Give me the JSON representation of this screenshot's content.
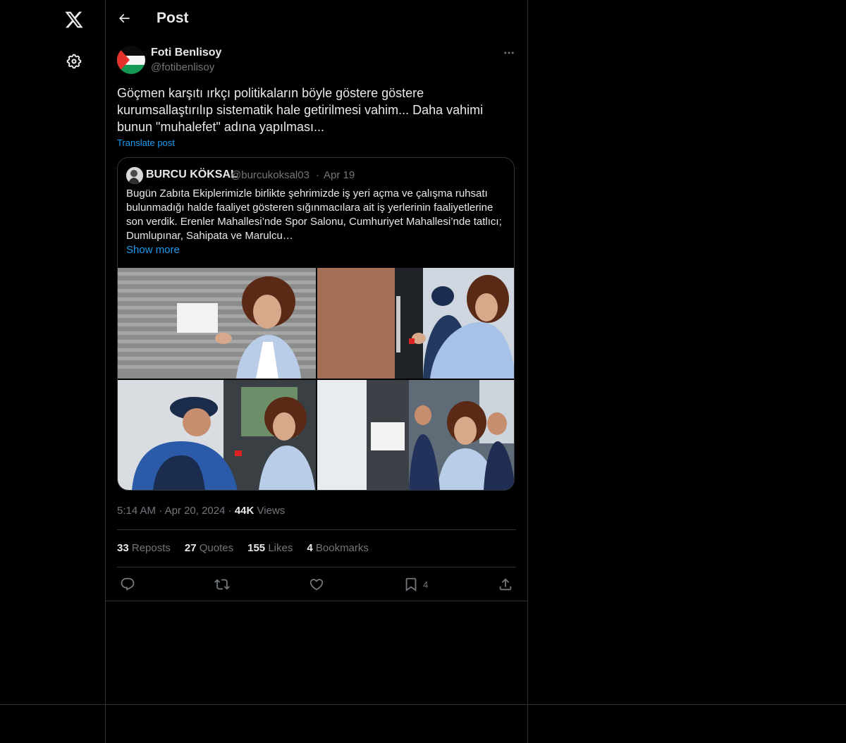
{
  "header": {
    "title": "Post"
  },
  "post": {
    "author_name": "Foti Benlisoy",
    "author_handle": "@fotibenlisoy",
    "text": "Göçmen karşıtı ırkçı politikaların böyle göstere göstere kurumsallaştırılıp sistematik hale getirilmesi vahim... Daha vahimi bunun \"muhalefet\" adına yapılması...",
    "translate_label": "Translate post",
    "time": "5:14 AM",
    "date": "Apr 20, 2024",
    "views_count": "44K",
    "views_label": "Views"
  },
  "quote": {
    "author_name": "BURCU KÖKSAL",
    "author_handle": "@burcukoksal03",
    "date": "Apr 19",
    "text": "Bugün Zabıta Ekiplerimizle birlikte şehrimizde iş yeri açma ve çalışma ruhsatı bulunmadığı halde faaliyet gösteren sığınmacılara ait iş yerlerinin faaliyetlerine son verdik. Erenler Mahallesi’nde Spor Salonu, Cumhuriyet Mahallesi’nde tatlıcı; Dumlupınar, Sahipata ve Marulcu…",
    "show_more": "Show more"
  },
  "stats": {
    "reposts_count": "33",
    "reposts_label": "Reposts",
    "quotes_count": "27",
    "quotes_label": "Quotes",
    "likes_count": "155",
    "likes_label": "Likes",
    "bookmarks_count": "4",
    "bookmarks_label": "Bookmarks"
  },
  "actions": {
    "bookmark_count": "4"
  },
  "icons": {
    "logo": "x-logo-icon",
    "settings": "gear-icon",
    "back": "arrow-left-icon",
    "more": "more-horizontal-icon",
    "reply": "reply-icon",
    "repost": "repost-icon",
    "like": "heart-icon",
    "bookmark": "bookmark-icon",
    "share": "share-icon"
  },
  "colors": {
    "background": "#000000",
    "accent": "#1d9bf0",
    "text": "#e7e9ea",
    "muted": "#71767b",
    "border": "#2f3336"
  }
}
